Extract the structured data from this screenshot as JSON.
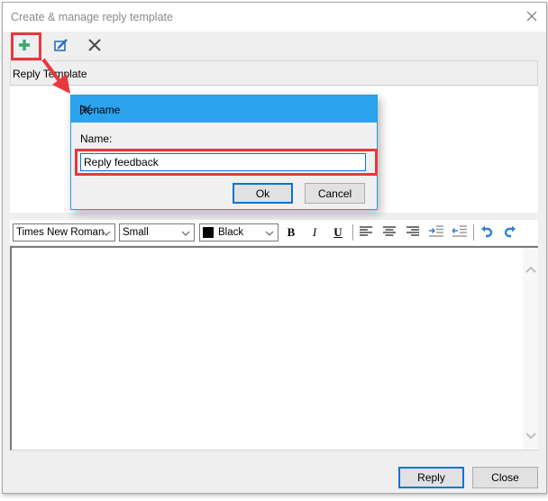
{
  "window": {
    "title": "Create & manage reply template",
    "close_icon": "close-icon"
  },
  "toolbar": {
    "items": [
      {
        "name": "add-template",
        "icon": "plus-icon",
        "highlighted": true
      },
      {
        "name": "rename-template",
        "icon": "edit-icon"
      },
      {
        "name": "delete-template",
        "icon": "delete-x-icon"
      }
    ]
  },
  "list": {
    "header": "Reply Template",
    "items": []
  },
  "format_bar": {
    "font": "Times New Roman",
    "size": "Small",
    "color_label": "Black",
    "color_swatch": "#000000",
    "buttons": [
      "bold-icon",
      "italic-icon",
      "underline-icon",
      "align-left-icon",
      "align-center-icon",
      "align-right-icon",
      "indent-icon",
      "outdent-icon",
      "undo-icon",
      "redo-icon"
    ],
    "bold": "B",
    "italic": "I",
    "underline": "U"
  },
  "editor": {
    "content": ""
  },
  "footer": {
    "reply_label": "Reply",
    "close_label": "Close"
  },
  "rename_dialog": {
    "title": "Rename",
    "name_label": "Name:",
    "name_value": "Reply feedback",
    "ok_label": "Ok",
    "cancel_label": "Cancel"
  },
  "colors": {
    "accent": "#2aa4ef",
    "highlight": "#e8383d",
    "focus": "#0a74d1",
    "plus_icon": "#3da86f",
    "edit_icon": "#2e6fc2"
  }
}
